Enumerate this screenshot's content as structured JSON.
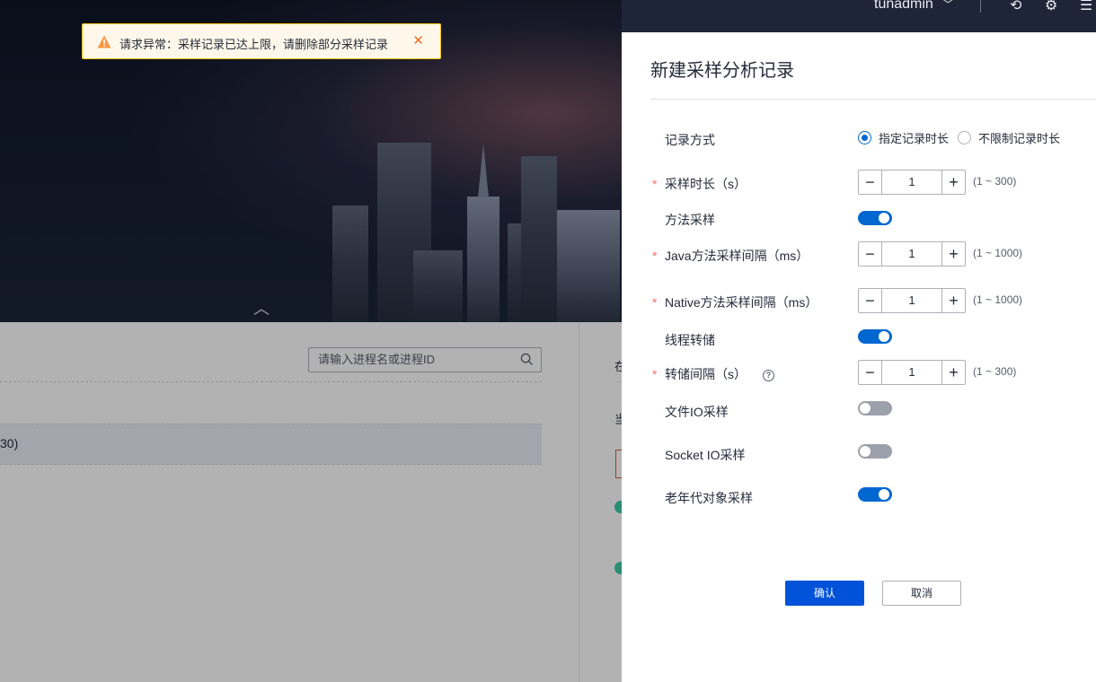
{
  "topbar": {
    "username": "tunadmin",
    "dropdown_icon": "chevron-down-icon",
    "icons": [
      "logout-icon",
      "gear-icon",
      "menu-icon"
    ]
  },
  "page": {
    "search_placeholder": "请输入进程名或进程ID",
    "row_text": "30)",
    "right_col": [
      "在",
      "当"
    ]
  },
  "toast": {
    "type": "warning",
    "message": "请求异常：采样记录已达上限，请删除部分采样记录",
    "accent": "#fac20a",
    "background": "#fff8ea"
  },
  "drawer": {
    "title": "新建采样分析记录",
    "fields": {
      "record_mode": {
        "label": "记录方式",
        "options": [
          "指定记录时长",
          "不限制记录时长"
        ],
        "selected": "指定记录时长"
      },
      "sample_duration": {
        "label": "采样时长（s）",
        "required": true,
        "value": "1",
        "range": "(1 ~ 300)"
      },
      "method_sampling": {
        "label": "方法采样",
        "enabled": true
      },
      "java_interval": {
        "label": "Java方法采样间隔（ms）",
        "required": true,
        "value": "1",
        "range": "(1 ~ 1000)"
      },
      "native_interval": {
        "label": "Native方法采样间隔（ms）",
        "required": true,
        "value": "1",
        "range": "(1 ~ 1000)"
      },
      "thread_dump": {
        "label": "线程转储",
        "enabled": true
      },
      "dump_interval": {
        "label": "转储间隔（s）",
        "required": true,
        "value": "1",
        "range": "(1 ~ 300)"
      },
      "file_io": {
        "label": "文件IO采样",
        "enabled": false
      },
      "socket_io": {
        "label": "Socket IO采样",
        "enabled": false
      },
      "old_gen": {
        "label": "老年代对象采样",
        "enabled": true
      }
    },
    "confirm_label": "确认",
    "cancel_label": "取消",
    "required_mark": "*",
    "accent": "#0067d1"
  }
}
